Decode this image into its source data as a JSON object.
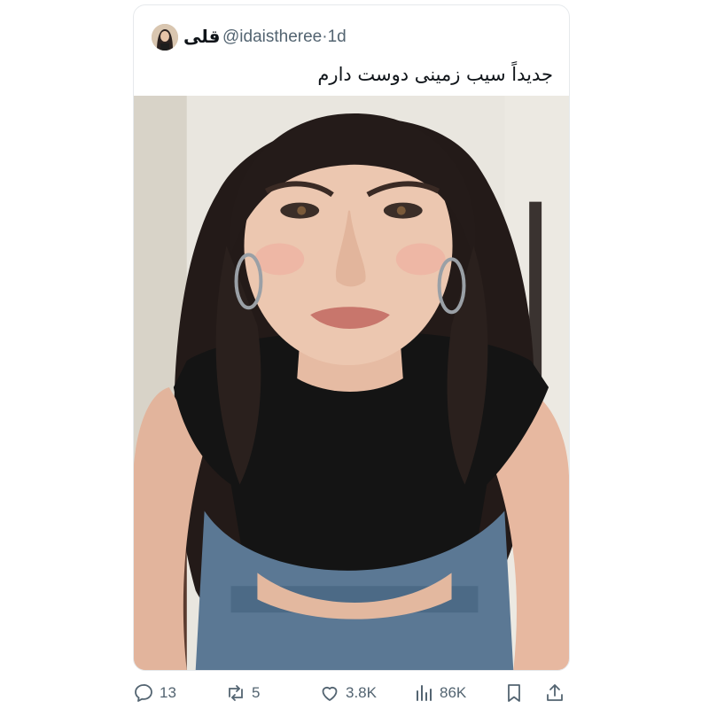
{
  "post": {
    "author_name": "قلی",
    "handle": "@idaistheree",
    "separator": "·",
    "age": "1d",
    "text": "جدیداً سیب زمینی دوست دارم"
  },
  "actions": {
    "replies": "13",
    "reposts": "5",
    "likes": "3.8K",
    "views": "86K"
  },
  "icons": {
    "reply": "reply-icon",
    "repost": "repost-icon",
    "like": "heart-icon",
    "views": "views-icon",
    "bookmark": "bookmark-icon",
    "share": "share-icon"
  },
  "colors": {
    "text": "#0f1419",
    "muted": "#536471",
    "border": "#e6e9ec"
  }
}
